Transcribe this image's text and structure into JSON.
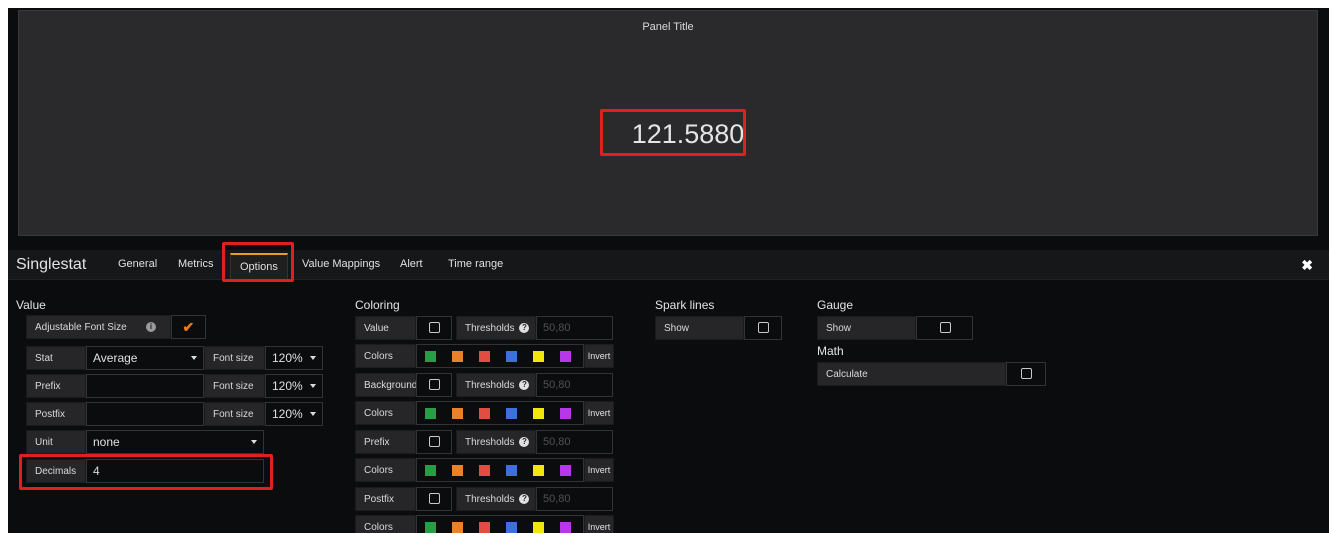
{
  "panel": {
    "title": "Panel Title",
    "value": "121.5880"
  },
  "editor": {
    "title": "Singlestat",
    "tabs": [
      "General",
      "Metrics",
      "Options",
      "Value Mappings",
      "Alert",
      "Time range"
    ],
    "active_tab": "Options"
  },
  "value_section": {
    "heading": "Value",
    "adjustable_font_size_label": "Adjustable Font Size",
    "adjustable_font_size_checked": true,
    "stat_label": "Stat",
    "stat_value": "Average",
    "font_size_label": "Font size",
    "stat_font_size": "120%",
    "prefix_label": "Prefix",
    "prefix_value": "",
    "prefix_font_size": "120%",
    "postfix_label": "Postfix",
    "postfix_value": "",
    "postfix_font_size": "120%",
    "unit_label": "Unit",
    "unit_value": "none",
    "decimals_label": "Decimals",
    "decimals_value": "4"
  },
  "coloring": {
    "heading": "Coloring",
    "rows": [
      {
        "label": "Value"
      },
      {
        "label": "Background"
      },
      {
        "label": "Prefix"
      },
      {
        "label": "Postfix"
      }
    ],
    "thresholds_label": "Thresholds",
    "thresholds_placeholder": "50,80",
    "colors_label": "Colors",
    "invert_label": "Invert",
    "swatch_colors": [
      "#299c46",
      "#ed8128",
      "#e24d42",
      "#3d71d9",
      "#f2e70d",
      "#b638e8"
    ]
  },
  "spark_lines": {
    "heading": "Spark lines",
    "show_label": "Show"
  },
  "gauge": {
    "heading": "Gauge",
    "show_label": "Show"
  },
  "math": {
    "heading": "Math",
    "calculate_label": "Calculate"
  },
  "icons": {
    "close": "close-icon",
    "info": "info-icon",
    "question": "question-icon",
    "check": "check-icon"
  }
}
